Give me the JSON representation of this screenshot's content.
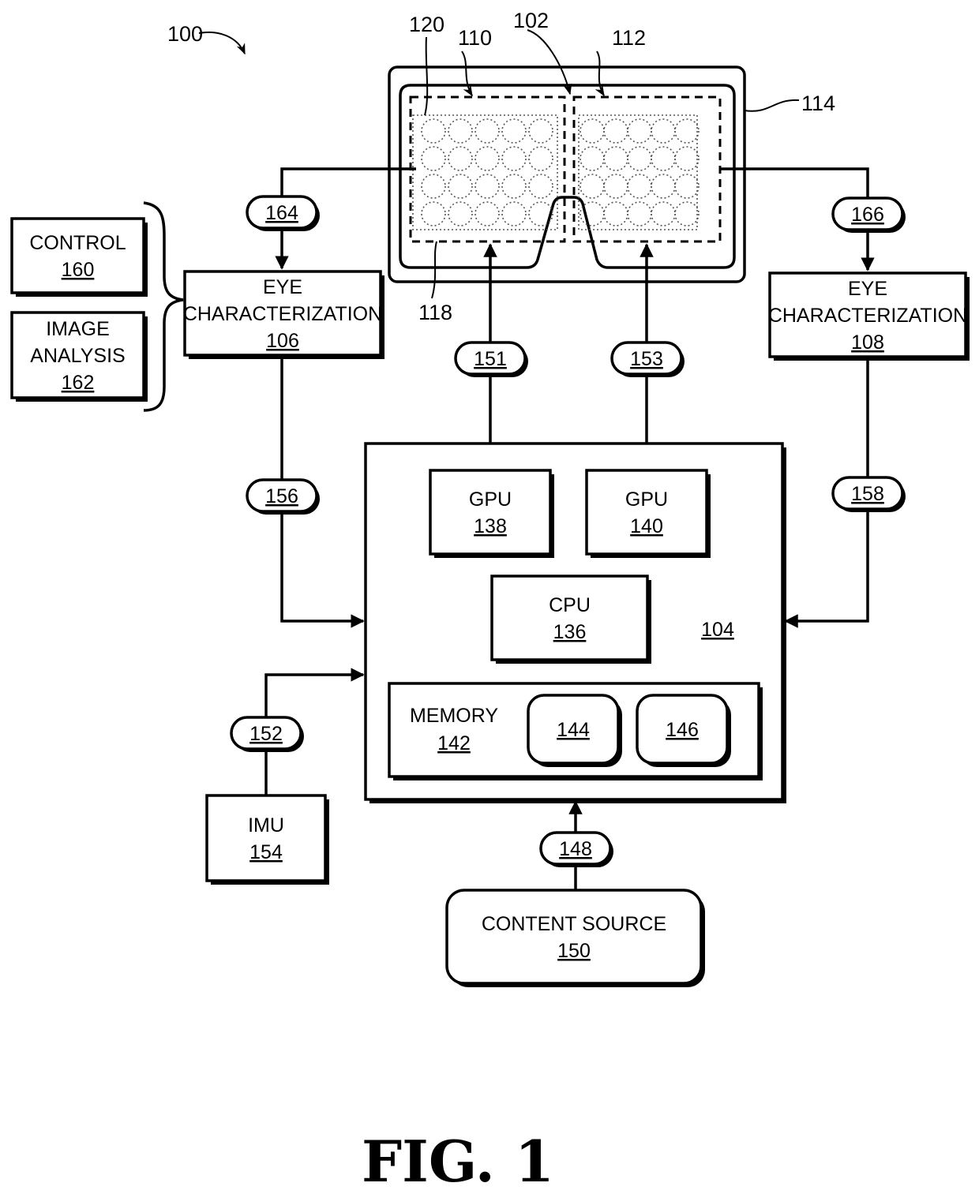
{
  "figure": {
    "caption": "FIG. 1",
    "system_ref": "100"
  },
  "display": {
    "hmd_ref": "114",
    "display_ref": "102",
    "left_region_ref": "110",
    "right_region_ref": "112",
    "lens_array_ref": "120",
    "frame_ref": "118"
  },
  "blocks": {
    "control": {
      "title": "CONTROL",
      "ref": "160"
    },
    "image_analysis": {
      "title_line1": "IMAGE",
      "title_line2": "ANALYSIS",
      "ref": "162"
    },
    "eye_char_left": {
      "title_line1": "EYE",
      "title_line2": "CHARACTERIZATION",
      "ref": "106"
    },
    "eye_char_right": {
      "title_line1": "EYE",
      "title_line2": "CHARACTERIZATION",
      "ref": "108"
    },
    "processing": {
      "ref": "104"
    },
    "gpu_left": {
      "title": "GPU",
      "ref": "138"
    },
    "gpu_right": {
      "title": "GPU",
      "ref": "140"
    },
    "cpu": {
      "title": "CPU",
      "ref": "136"
    },
    "memory": {
      "title": "MEMORY",
      "ref": "142"
    },
    "mem_item_1": {
      "ref": "144"
    },
    "mem_item_2": {
      "ref": "146"
    },
    "imu": {
      "title": "IMU",
      "ref": "154"
    },
    "content_source": {
      "title": "CONTENT SOURCE",
      "ref": "150"
    }
  },
  "connectors": {
    "c164": "164",
    "c166": "166",
    "c151": "151",
    "c153": "153",
    "c156": "156",
    "c158": "158",
    "c152": "152",
    "c148": "148"
  }
}
